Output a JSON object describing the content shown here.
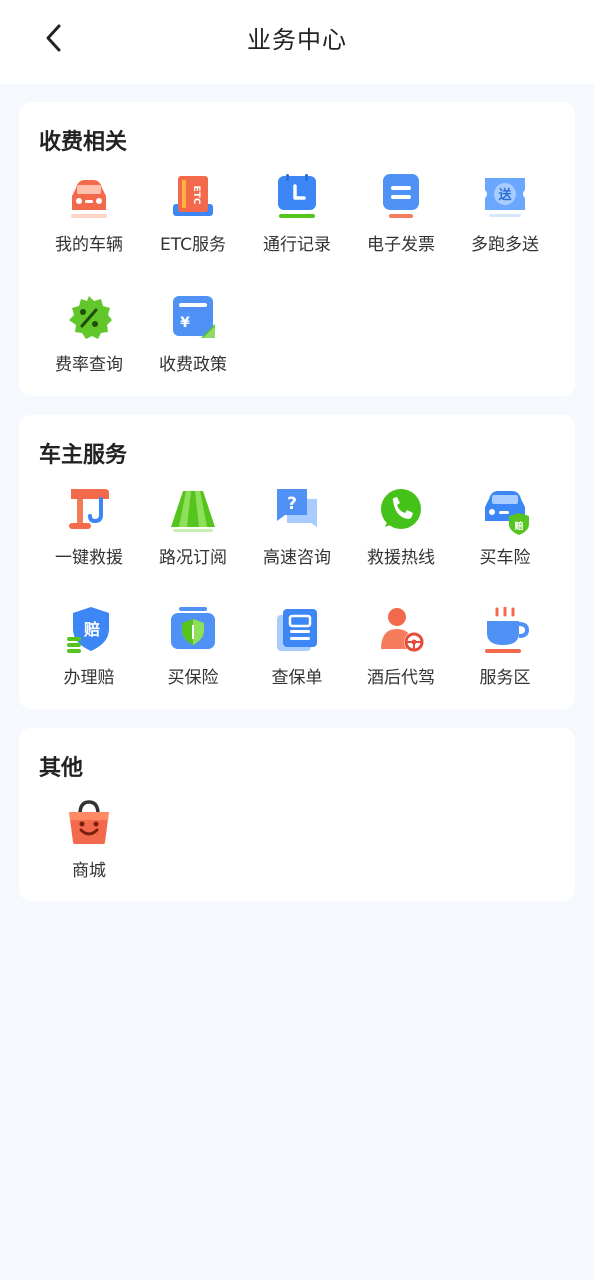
{
  "header": {
    "title": "业务中心"
  },
  "sections": [
    {
      "title": "收费相关",
      "items": [
        {
          "label": "我的车辆",
          "icon": "car-icon"
        },
        {
          "label": "ETC服务",
          "icon": "etc-card-icon"
        },
        {
          "label": "通行记录",
          "icon": "clock-record-icon"
        },
        {
          "label": "电子发票",
          "icon": "invoice-icon"
        },
        {
          "label": "多跑多送",
          "icon": "gift-coupon-icon"
        },
        {
          "label": "费率查询",
          "icon": "percent-badge-icon"
        },
        {
          "label": "收费政策",
          "icon": "yen-document-icon"
        }
      ]
    },
    {
      "title": "车主服务",
      "items": [
        {
          "label": "一键救援",
          "icon": "tow-crane-icon"
        },
        {
          "label": "路况订阅",
          "icon": "road-icon"
        },
        {
          "label": "高速咨询",
          "icon": "question-chat-icon"
        },
        {
          "label": "救援热线",
          "icon": "phone-icon"
        },
        {
          "label": "买车险",
          "icon": "car-insurance-icon"
        },
        {
          "label": "办理赔",
          "icon": "claim-shield-icon"
        },
        {
          "label": "买保险",
          "icon": "insurance-shield-icon"
        },
        {
          "label": "查保单",
          "icon": "policy-document-icon"
        },
        {
          "label": "酒后代驾",
          "icon": "driver-icon"
        },
        {
          "label": "服务区",
          "icon": "coffee-cup-icon"
        }
      ]
    },
    {
      "title": "其他",
      "items": [
        {
          "label": "商城",
          "icon": "shopping-bag-icon"
        }
      ]
    }
  ],
  "icon_text": {
    "etc": "ETC",
    "gift": "送",
    "yen": "¥",
    "claim": "赔",
    "car_badge": "赔"
  },
  "colors": {
    "background": "#f5f8fd",
    "card": "#ffffff",
    "blue": "#3d86f5",
    "orange": "#f26a4b",
    "green": "#56c41f"
  }
}
